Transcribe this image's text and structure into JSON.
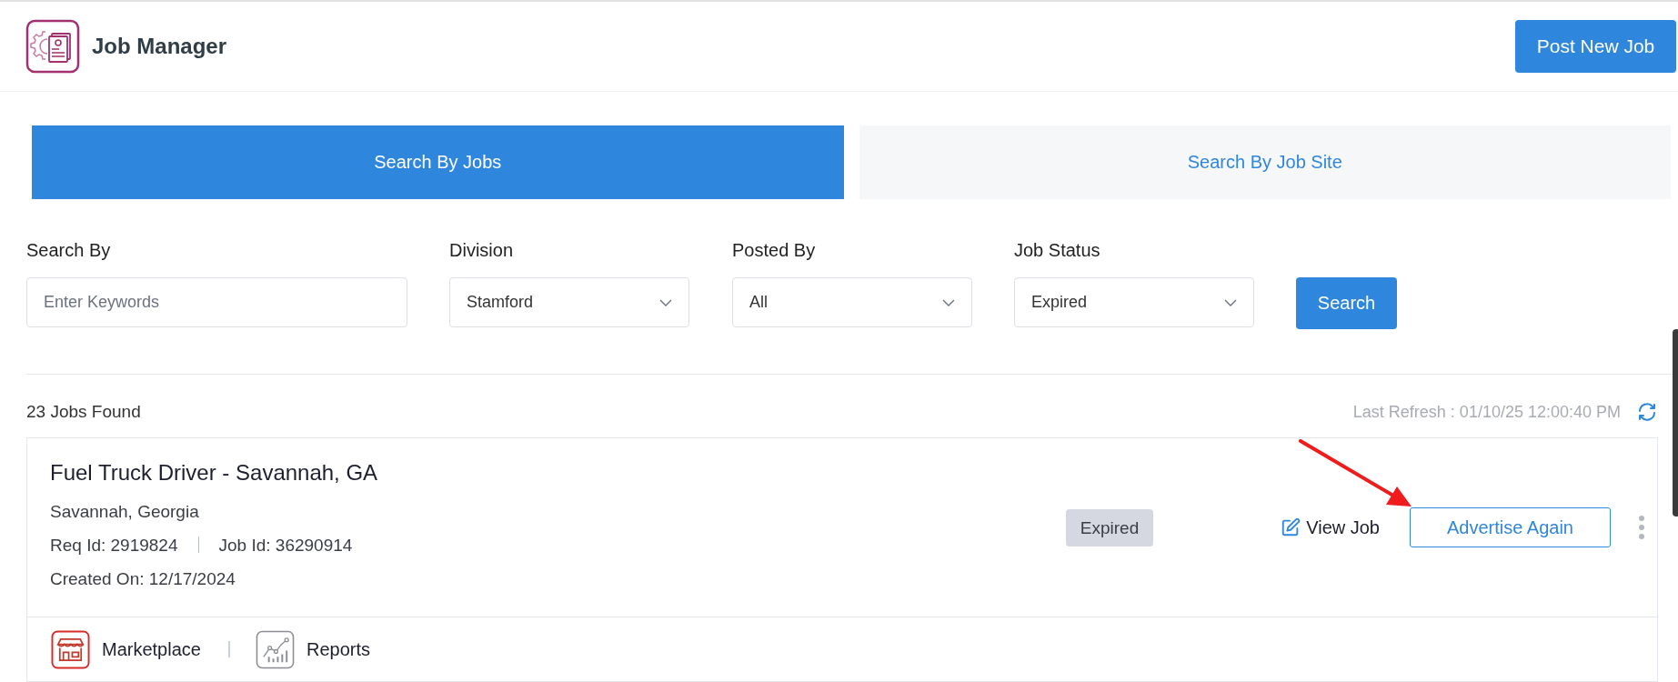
{
  "header": {
    "title": "Job Manager",
    "post_button": "Post New Job"
  },
  "tabs": [
    {
      "label": "Search By Jobs",
      "selected": true
    },
    {
      "label": "Search By Job Site",
      "selected": false
    }
  ],
  "filters": [
    {
      "kind": "text",
      "label": "Search By",
      "placeholder": "Enter Keywords"
    },
    {
      "kind": "select",
      "label": "Division",
      "value": "Stamford"
    },
    {
      "kind": "select",
      "label": "Posted By",
      "value": "All"
    },
    {
      "kind": "select",
      "label": "Job Status",
      "value": "Expired"
    }
  ],
  "search_button": "Search",
  "results": {
    "count": "23 Jobs Found",
    "last_refresh": "Last Refresh : 01/10/25 12:00:40 PM"
  },
  "jobs": [
    {
      "title": "Fuel Truck Driver - Savannah, GA",
      "location": "Savannah, Georgia",
      "req_id": "Req Id: 2919824",
      "job_id": "Job Id: 36290914",
      "created": "Created On: 12/17/2024",
      "status": "Expired",
      "view": "View Job",
      "advertise": "Advertise Again",
      "links": [
        {
          "kind": "marketplace",
          "label": "Marketplace"
        },
        {
          "kind": "reports",
          "label": "Reports"
        }
      ]
    }
  ]
}
